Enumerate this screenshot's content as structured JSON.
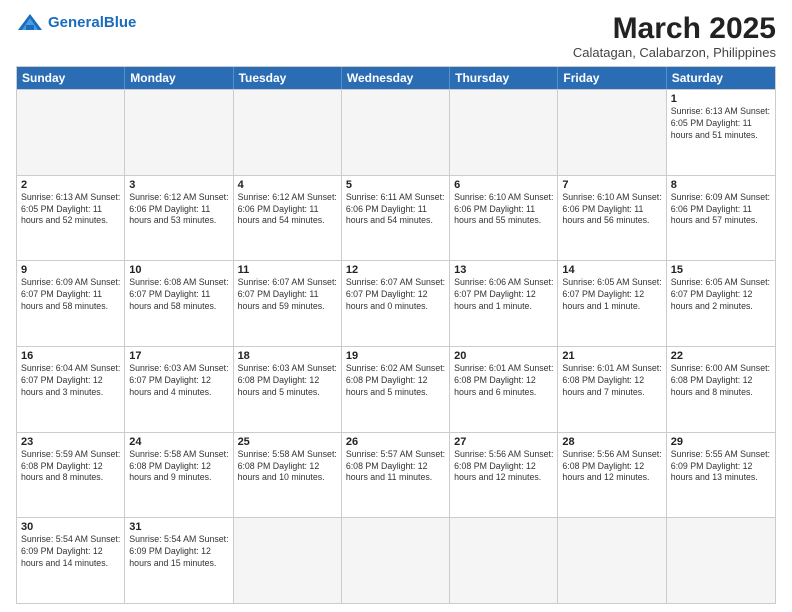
{
  "header": {
    "logo_general": "General",
    "logo_blue": "Blue",
    "month_title": "March 2025",
    "subtitle": "Calatagan, Calabarzon, Philippines"
  },
  "weekdays": [
    "Sunday",
    "Monday",
    "Tuesday",
    "Wednesday",
    "Thursday",
    "Friday",
    "Saturday"
  ],
  "rows": [
    [
      {
        "day": "",
        "info": ""
      },
      {
        "day": "",
        "info": ""
      },
      {
        "day": "",
        "info": ""
      },
      {
        "day": "",
        "info": ""
      },
      {
        "day": "",
        "info": ""
      },
      {
        "day": "",
        "info": ""
      },
      {
        "day": "1",
        "info": "Sunrise: 6:13 AM\nSunset: 6:05 PM\nDaylight: 11 hours and 51 minutes."
      }
    ],
    [
      {
        "day": "2",
        "info": "Sunrise: 6:13 AM\nSunset: 6:05 PM\nDaylight: 11 hours and 52 minutes."
      },
      {
        "day": "3",
        "info": "Sunrise: 6:12 AM\nSunset: 6:06 PM\nDaylight: 11 hours and 53 minutes."
      },
      {
        "day": "4",
        "info": "Sunrise: 6:12 AM\nSunset: 6:06 PM\nDaylight: 11 hours and 54 minutes."
      },
      {
        "day": "5",
        "info": "Sunrise: 6:11 AM\nSunset: 6:06 PM\nDaylight: 11 hours and 54 minutes."
      },
      {
        "day": "6",
        "info": "Sunrise: 6:10 AM\nSunset: 6:06 PM\nDaylight: 11 hours and 55 minutes."
      },
      {
        "day": "7",
        "info": "Sunrise: 6:10 AM\nSunset: 6:06 PM\nDaylight: 11 hours and 56 minutes."
      },
      {
        "day": "8",
        "info": "Sunrise: 6:09 AM\nSunset: 6:06 PM\nDaylight: 11 hours and 57 minutes."
      }
    ],
    [
      {
        "day": "9",
        "info": "Sunrise: 6:09 AM\nSunset: 6:07 PM\nDaylight: 11 hours and 58 minutes."
      },
      {
        "day": "10",
        "info": "Sunrise: 6:08 AM\nSunset: 6:07 PM\nDaylight: 11 hours and 58 minutes."
      },
      {
        "day": "11",
        "info": "Sunrise: 6:07 AM\nSunset: 6:07 PM\nDaylight: 11 hours and 59 minutes."
      },
      {
        "day": "12",
        "info": "Sunrise: 6:07 AM\nSunset: 6:07 PM\nDaylight: 12 hours and 0 minutes."
      },
      {
        "day": "13",
        "info": "Sunrise: 6:06 AM\nSunset: 6:07 PM\nDaylight: 12 hours and 1 minute."
      },
      {
        "day": "14",
        "info": "Sunrise: 6:05 AM\nSunset: 6:07 PM\nDaylight: 12 hours and 1 minute."
      },
      {
        "day": "15",
        "info": "Sunrise: 6:05 AM\nSunset: 6:07 PM\nDaylight: 12 hours and 2 minutes."
      }
    ],
    [
      {
        "day": "16",
        "info": "Sunrise: 6:04 AM\nSunset: 6:07 PM\nDaylight: 12 hours and 3 minutes."
      },
      {
        "day": "17",
        "info": "Sunrise: 6:03 AM\nSunset: 6:07 PM\nDaylight: 12 hours and 4 minutes."
      },
      {
        "day": "18",
        "info": "Sunrise: 6:03 AM\nSunset: 6:08 PM\nDaylight: 12 hours and 5 minutes."
      },
      {
        "day": "19",
        "info": "Sunrise: 6:02 AM\nSunset: 6:08 PM\nDaylight: 12 hours and 5 minutes."
      },
      {
        "day": "20",
        "info": "Sunrise: 6:01 AM\nSunset: 6:08 PM\nDaylight: 12 hours and 6 minutes."
      },
      {
        "day": "21",
        "info": "Sunrise: 6:01 AM\nSunset: 6:08 PM\nDaylight: 12 hours and 7 minutes."
      },
      {
        "day": "22",
        "info": "Sunrise: 6:00 AM\nSunset: 6:08 PM\nDaylight: 12 hours and 8 minutes."
      }
    ],
    [
      {
        "day": "23",
        "info": "Sunrise: 5:59 AM\nSunset: 6:08 PM\nDaylight: 12 hours and 8 minutes."
      },
      {
        "day": "24",
        "info": "Sunrise: 5:58 AM\nSunset: 6:08 PM\nDaylight: 12 hours and 9 minutes."
      },
      {
        "day": "25",
        "info": "Sunrise: 5:58 AM\nSunset: 6:08 PM\nDaylight: 12 hours and 10 minutes."
      },
      {
        "day": "26",
        "info": "Sunrise: 5:57 AM\nSunset: 6:08 PM\nDaylight: 12 hours and 11 minutes."
      },
      {
        "day": "27",
        "info": "Sunrise: 5:56 AM\nSunset: 6:08 PM\nDaylight: 12 hours and 12 minutes."
      },
      {
        "day": "28",
        "info": "Sunrise: 5:56 AM\nSunset: 6:08 PM\nDaylight: 12 hours and 12 minutes."
      },
      {
        "day": "29",
        "info": "Sunrise: 5:55 AM\nSunset: 6:09 PM\nDaylight: 12 hours and 13 minutes."
      }
    ],
    [
      {
        "day": "30",
        "info": "Sunrise: 5:54 AM\nSunset: 6:09 PM\nDaylight: 12 hours and 14 minutes."
      },
      {
        "day": "31",
        "info": "Sunrise: 5:54 AM\nSunset: 6:09 PM\nDaylight: 12 hours and 15 minutes."
      },
      {
        "day": "",
        "info": ""
      },
      {
        "day": "",
        "info": ""
      },
      {
        "day": "",
        "info": ""
      },
      {
        "day": "",
        "info": ""
      },
      {
        "day": "",
        "info": ""
      }
    ]
  ]
}
